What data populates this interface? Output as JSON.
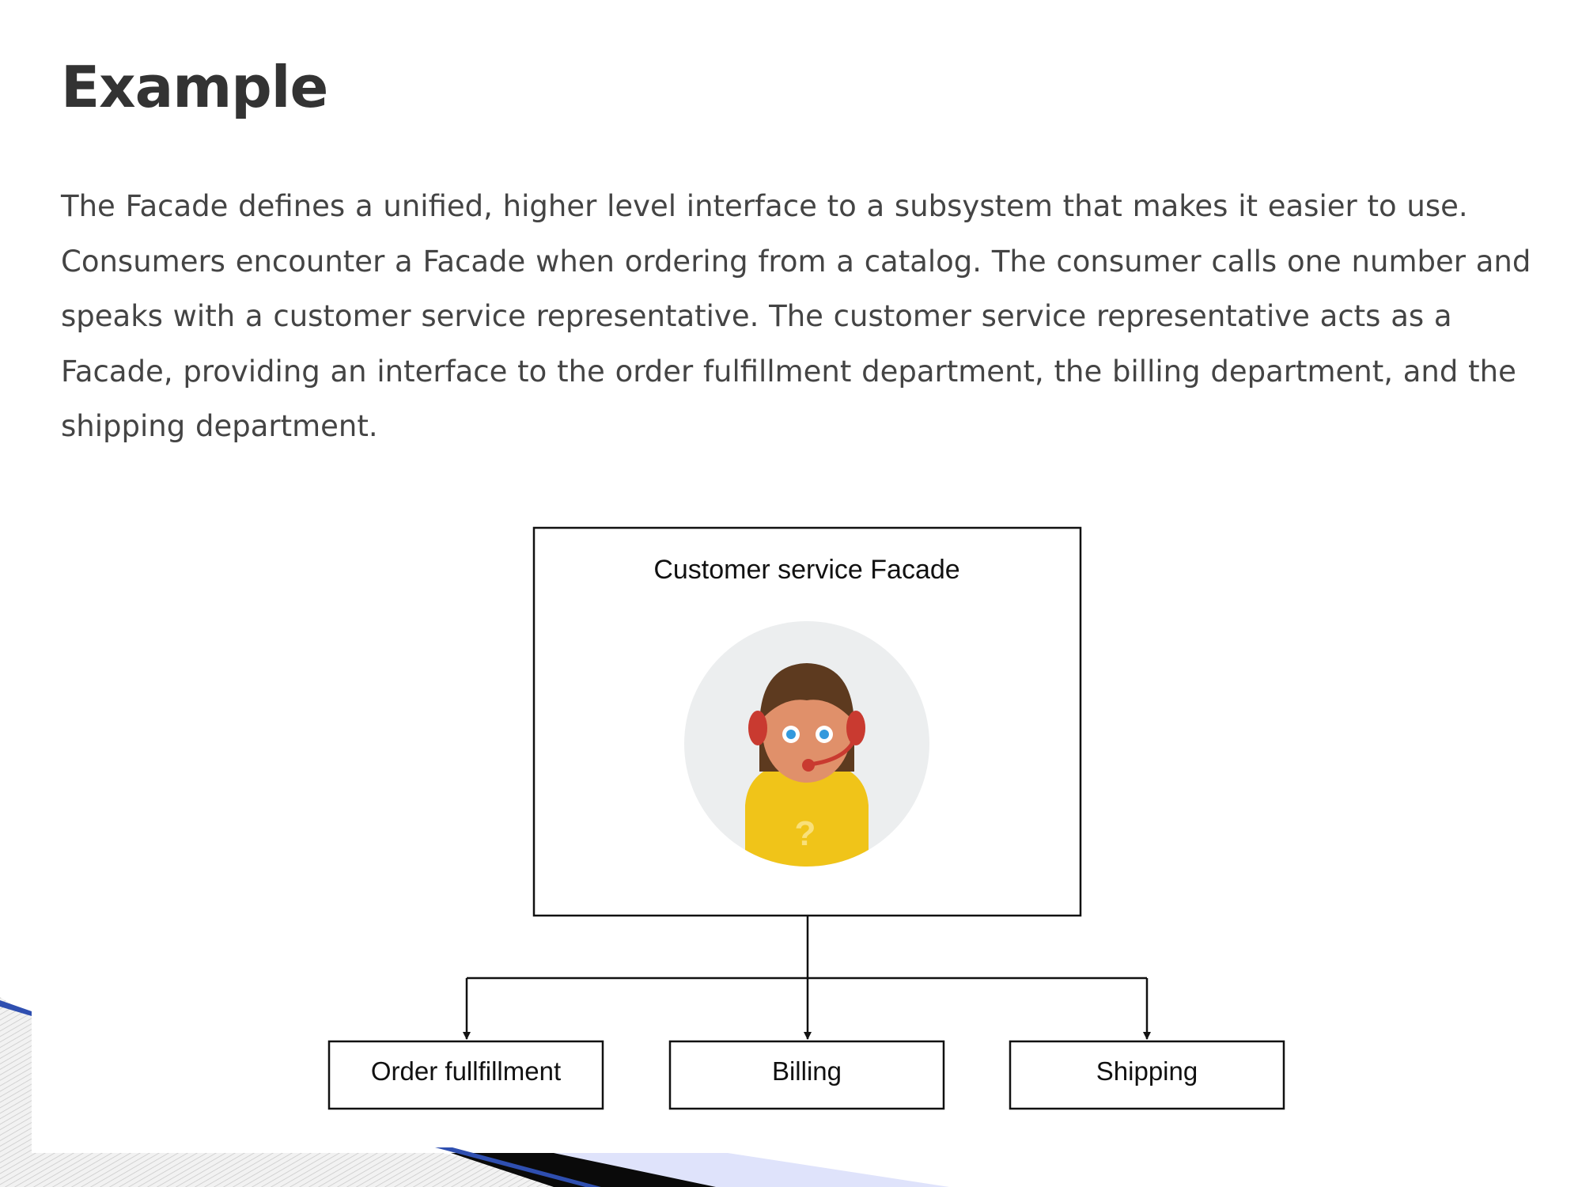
{
  "page": {
    "title": "Example",
    "body": "The Facade defines a unified, higher level interface to a subsystem that makes it easier to use. Consumers encounter a Facade when ordering from a catalog. The consumer calls one number and speaks with a customer service representative. The customer service representative acts as a Facade, providing an interface to the order fulfillment department, the billing department, and the shipping department."
  },
  "diagram": {
    "facade": {
      "label": "Customer service Facade",
      "icon": "customer-service-agent-icon"
    },
    "subsystems": [
      {
        "label": "Order fullfillment"
      },
      {
        "label": "Billing"
      },
      {
        "label": "Shipping"
      }
    ]
  },
  "colors": {
    "title": "#333333",
    "body_text": "#444444",
    "diagram_stroke": "#111111",
    "avatar_bg": "#eceeef",
    "hair": "#5d3a1f",
    "skin": "#e0906a",
    "headset": "#c93a30",
    "shirt": "#f0c419",
    "eyes": "#3399dd",
    "slide_accent_blue": "#2f4fb0",
    "slide_accent_light": "#dfe3fb"
  }
}
